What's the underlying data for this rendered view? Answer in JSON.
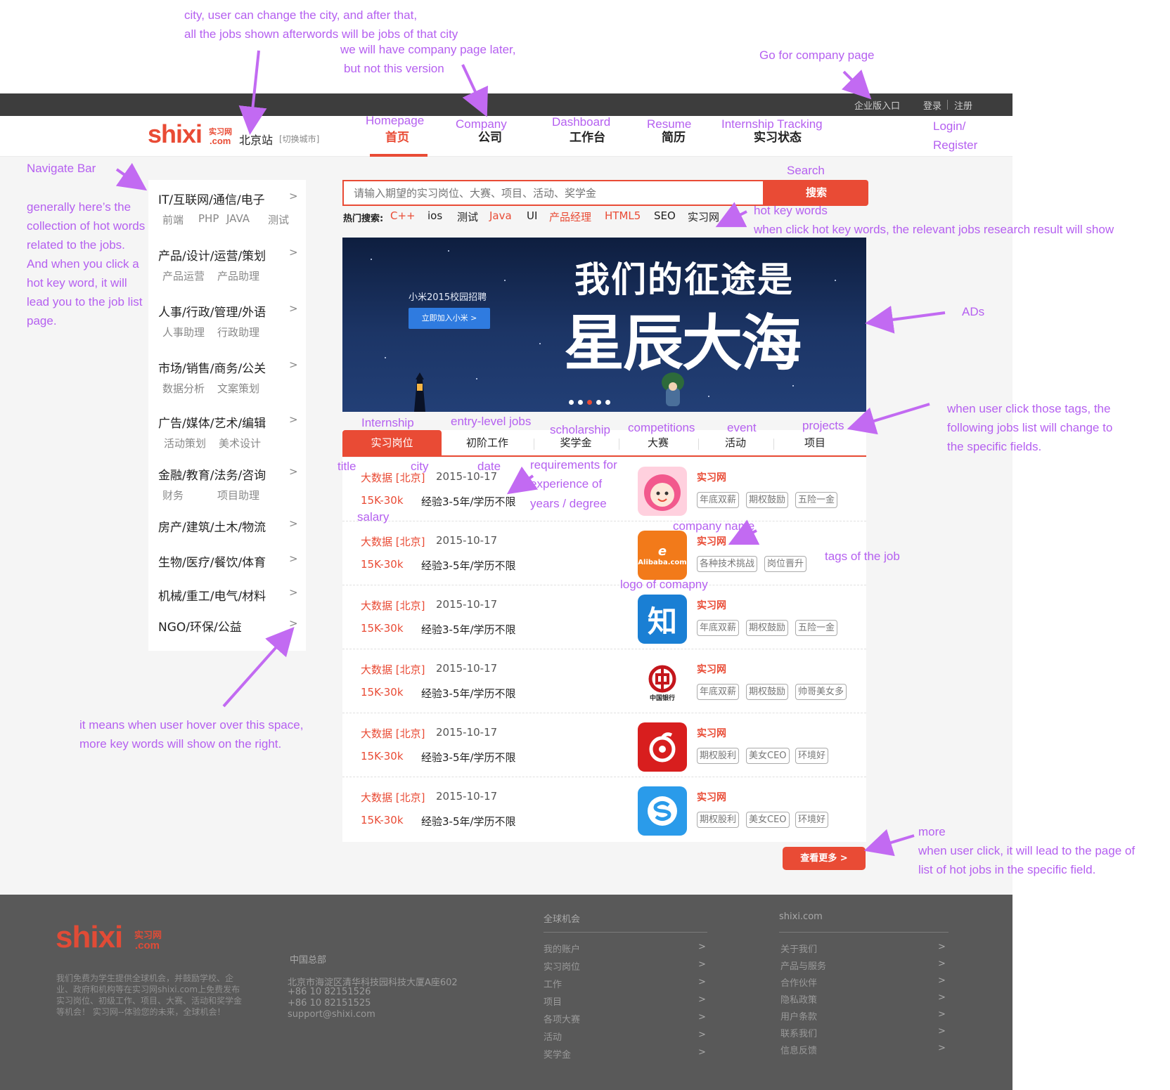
{
  "annotations": {
    "city_line1": "city, user can change the city, and after that,",
    "city_line2": "all the jobs shown afterwords will be jobs of that city",
    "company_line1": "we will have company page later,",
    "company_line2": "but not this version",
    "go_company": "Go for company page",
    "homepage": "Homepage",
    "company": "Company",
    "dashboard": "Dashboard",
    "resume": "Resume",
    "tracking": "Internship Tracking",
    "login_line1": "Login/",
    "login_line2": "Register",
    "navigate_bar": "Navigate Bar",
    "navigate_desc": "generally here’s the collection of hot words related to the jobs. And when you click a hot key word, it will lead you to the job list page.",
    "search": "Search",
    "hot_key_words": "hot key words",
    "hot_key_desc": "when click hot key words, the relevant jobs research result will show",
    "ads": "ADs",
    "tags_line1": "when user click those tags, the",
    "tags_line2": "following jobs list will change to",
    "tags_line3": "the specific fields.",
    "internship": "Internship",
    "entry_level": "entry-level jobs",
    "scholarship": "scholarship",
    "competitions": "competitions",
    "event": "event",
    "projects": "projects",
    "title": "title",
    "city": "city",
    "date": "date",
    "req_line1": "requirements for",
    "req_line2": "experience of",
    "req_line3": "years / degree",
    "salary": "salary",
    "company_name": "company name",
    "tags_of_job": "tags of the job",
    "logo_of_company": "logo of comapny",
    "hover_line1": "it means when user hover over this space,",
    "hover_line2": "more key words will show on the right.",
    "more": "more",
    "more_line1": "when user click, it will lead to the page of",
    "more_line2": "list of hot jobs in the specific field."
  },
  "topbar": {
    "enterprise": "企业版入口",
    "login": "登录",
    "register": "注册"
  },
  "header": {
    "logo_main": "shixi",
    "logo_cn": "实习网",
    "logo_com": ".com",
    "city": "北京站",
    "switch_city": "[切换城市]",
    "nav": {
      "home": "首页",
      "company": "公司",
      "dashboard": "工作台",
      "resume": "简历",
      "status": "实习状态"
    }
  },
  "sidebar": {
    "categories": [
      {
        "title": "IT/互联网/通信/电子",
        "subs": [
          "前端",
          "PHP",
          "JAVA",
          "测试"
        ]
      },
      {
        "title": "产品/设计/运营/策划",
        "subs": [
          "产品运营",
          "产品助理"
        ]
      },
      {
        "title": "人事/行政/管理/外语",
        "subs": [
          "人事助理",
          "行政助理"
        ]
      },
      {
        "title": "市场/销售/商务/公关",
        "subs": [
          "数据分析",
          "文案策划"
        ]
      },
      {
        "title": "广告/媒体/艺术/编辑",
        "subs": [
          "活动策划",
          "美术设计"
        ]
      },
      {
        "title": "金融/教育/法务/咨询",
        "subs": [
          "财务",
          "项目助理"
        ]
      },
      {
        "title": "房产/建筑/土木/物流",
        "subs": []
      },
      {
        "title": "生物/医疗/餐饮/体育",
        "subs": []
      },
      {
        "title": "机械/重工/电气/材料",
        "subs": []
      },
      {
        "title": "NGO/环保/公益",
        "subs": []
      }
    ],
    "arrow": ">"
  },
  "search": {
    "placeholder": "请输入期望的实习岗位、大赛、项目、活动、奖学金",
    "button": "搜索",
    "hot_label": "热门搜索:",
    "hot_words": [
      "C++",
      "ios",
      "测试",
      "Java",
      "UI",
      "产品经理",
      "HTML5",
      "SEO",
      "实习网"
    ]
  },
  "banner": {
    "small_text": "小米2015校园招聘",
    "button": "立即加入小米 >",
    "line1": "我们的征途是",
    "line2": "星辰大海"
  },
  "tabs": [
    "实习岗位",
    "初阶工作",
    "奖学金",
    "大赛",
    "活动",
    "项目"
  ],
  "jobs": [
    {
      "title": "大数据 [北京]",
      "date": "2015-10-17",
      "salary": "15K-30k",
      "req": "经验3-5年/学历不限",
      "company": "实习网",
      "logo": "girl-face",
      "tags": [
        "年底双薪",
        "期权鼓励",
        "五险一金"
      ]
    },
    {
      "title": "大数据 [北京]",
      "date": "2015-10-17",
      "salary": "15K-30k",
      "req": "经验3-5年/学历不限",
      "company": "实习网",
      "logo": "alibaba",
      "logo_text": "Alibaba.com",
      "tags": [
        "各种技术挑战",
        "岗位晋升"
      ]
    },
    {
      "title": "大数据 [北京]",
      "date": "2015-10-17",
      "salary": "15K-30k",
      "req": "经验3-5年/学历不限",
      "company": "实习网",
      "logo": "zhihu",
      "logo_text": "知",
      "tags": [
        "年底双薪",
        "期权鼓励",
        "五险一金"
      ]
    },
    {
      "title": "大数据 [北京]",
      "date": "2015-10-17",
      "salary": "15K-30k",
      "req": "经验3-5年/学历不限",
      "company": "实习网",
      "logo": "bank-of-china",
      "logo_text": "中国银行",
      "tags": [
        "年底双薪",
        "期权鼓励",
        "帅哥美女多"
      ]
    },
    {
      "title": "大数据 [北京]",
      "date": "2015-10-17",
      "salary": "15K-30k",
      "req": "经验3-5年/学历不限",
      "company": "实习网",
      "logo": "netease-music",
      "tags": [
        "期权股利",
        "美女CEO",
        "环境好"
      ]
    },
    {
      "title": "大数据 [北京]",
      "date": "2015-10-17",
      "salary": "15K-30k",
      "req": "经验3-5年/学历不限",
      "company": "实习网",
      "logo": "sogou",
      "tags": [
        "期权股利",
        "美女CEO",
        "环境好"
      ]
    }
  ],
  "more_button": "查看更多 >",
  "footer": {
    "desc": "我们免费为学生提供全球机会，并鼓励学校、企业、政府和机构等在实习网shixi.com上免费发布实习岗位、初级工作、项目、大赛、活动和奖学金等机会！ 实习网--体验您的未来，全球机会！",
    "hq_title": "中国总部",
    "address": "北京市海淀区清华科技园科技大厦A座602",
    "phone1": "+86 10 82151526",
    "phone2": "+86 10 82151525",
    "email": "support@shixi.com",
    "col1_title": "全球机会",
    "col1_items": [
      "我的账户",
      "实习岗位",
      "工作",
      "项目",
      "各项大赛",
      "活动",
      "奖学金"
    ],
    "col2_title": "shixi.com",
    "col2_items": [
      "关于我们",
      "产品与服务",
      "合作伙伴",
      "隐私政策",
      "用户条款",
      "联系我们",
      "信息反馈"
    ],
    "arrow": ">"
  },
  "colors": {
    "brand": "#e94b35",
    "annotation": "#b560f0",
    "topbar": "#3d3d3d",
    "footer": "#595959"
  }
}
